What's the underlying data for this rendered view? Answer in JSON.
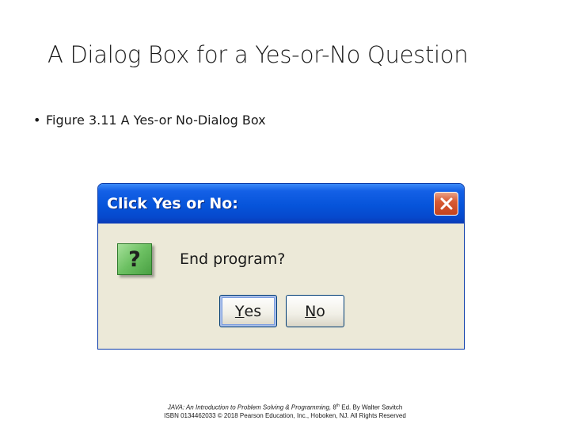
{
  "slide": {
    "title": "A Dialog Box for a Yes-or-No Question",
    "bullet": "Figure 3.11 A Yes-or No-Dialog Box"
  },
  "dialog": {
    "title": "Click Yes or No:",
    "icon": "question-icon",
    "icon_glyph": "?",
    "message": "End program?",
    "buttons": {
      "yes_mnemonic": "Y",
      "yes_rest": "es",
      "no_mnemonic": "N",
      "no_rest": "o"
    },
    "colors": {
      "titlebar": "#0654da",
      "body": "#ece9d8",
      "close": "#d85a33",
      "icon": "#6cc062"
    }
  },
  "footer": {
    "line1_italic": "JAVA: An Introduction to Problem Solving & Programming,",
    "line1_edition": " 8",
    "line1_sup": "th",
    "line1_rest": " Ed. By Walter Savitch",
    "line2": "ISBN 0134462033 © 2018 Pearson Education, Inc., Hoboken, NJ. All Rights Reserved"
  }
}
